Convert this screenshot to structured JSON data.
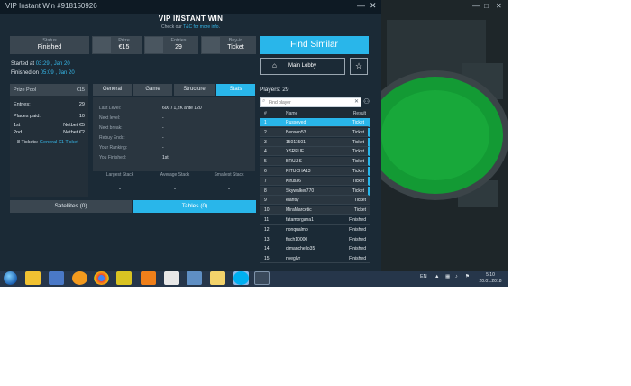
{
  "window": {
    "title": "VIP Instant Win #918150926",
    "controls": {
      "minimize": "—",
      "close": "✕"
    }
  },
  "header": {
    "title": "VIP INSTANT WIN",
    "subtitle_prefix": "Check our ",
    "subtitle_link": "T&C for more info",
    "subtitle_suffix": "."
  },
  "tiles": [
    {
      "label": "Status",
      "value": "Finished",
      "icon": "none"
    },
    {
      "label": "Prize",
      "value": "€15",
      "icon": "prize-icon"
    },
    {
      "label": "Entries",
      "value": "29",
      "icon": "entries-icon"
    },
    {
      "label": "Buy-in",
      "value": "Ticket",
      "icon": "buyin-icon"
    }
  ],
  "times": {
    "started_label": "Started at ",
    "started_value": "03:29 , Jan 20",
    "finished_label": "Finished on ",
    "finished_value": "05:09 , Jan 20"
  },
  "actions": {
    "find_similar": "Find Similar",
    "main_lobby": "Main Lobby"
  },
  "prize_panel": {
    "prize_pool_label": "Prize Pool",
    "prize_pool_value": "€15",
    "entries_label": "Entries:",
    "entries_value": "29",
    "places_paid_label": "Places paid:",
    "places_paid_value": "10",
    "places": [
      {
        "place": "1st",
        "prize": "Netbet €5"
      },
      {
        "place": "2nd",
        "prize": "Netbet €2"
      }
    ],
    "tickets_prefix": "8 Tickets: ",
    "tickets_value": "General €1 Ticket"
  },
  "tabs": [
    {
      "label": "General",
      "active": false
    },
    {
      "label": "Game",
      "active": false
    },
    {
      "label": "Structure",
      "active": false
    },
    {
      "label": "Stats",
      "active": true
    }
  ],
  "stats": [
    {
      "label": "Last Level:",
      "value": "600 / 1,2K ante 120"
    },
    {
      "label": "Next level:",
      "value": "-"
    },
    {
      "label": "Next break:",
      "value": "-"
    },
    {
      "label": "Rebuy Ends:",
      "value": "-"
    },
    {
      "label": "Your Ranking:",
      "value": "-"
    },
    {
      "label": "You Finished:",
      "value": "1st"
    }
  ],
  "stacks": [
    {
      "label": "Largest Stack",
      "value": "-"
    },
    {
      "label": "Average Stack",
      "value": "-"
    },
    {
      "label": "Smallest Stack",
      "value": "-"
    }
  ],
  "bottom_tabs": [
    {
      "label": "Satellites (0)",
      "active": false
    },
    {
      "label": "Tables (0)",
      "active": true
    }
  ],
  "players": {
    "label": "Players: ",
    "count": "29",
    "search_placeholder": "Find player",
    "columns": {
      "rank": "#",
      "name": "Name",
      "result": "Result"
    },
    "rows": [
      {
        "rank": "1",
        "name": "Russoved",
        "result": "Ticket"
      },
      {
        "rank": "2",
        "name": "Benson53",
        "result": "Ticket"
      },
      {
        "rank": "3",
        "name": "15011501",
        "result": "Ticket"
      },
      {
        "rank": "4",
        "name": "XSRFUF",
        "result": "Ticket"
      },
      {
        "rank": "5",
        "name": "BRUJIS",
        "result": "Ticket"
      },
      {
        "rank": "6",
        "name": "PITUCHA13",
        "result": "Ticket"
      },
      {
        "rank": "7",
        "name": "Kirus36",
        "result": "Ticket"
      },
      {
        "rank": "8",
        "name": "Skywalker770",
        "result": "Ticket"
      },
      {
        "rank": "9",
        "name": "elantiy",
        "result": "Ticket"
      },
      {
        "rank": "10",
        "name": "MiraMarcetic",
        "result": "Ticket"
      },
      {
        "rank": "11",
        "name": "fatamorgana1",
        "result": "Finished"
      },
      {
        "rank": "12",
        "name": "nonqualmo",
        "result": "Finished"
      },
      {
        "rank": "13",
        "name": "fisch10000",
        "result": "Finished"
      },
      {
        "rank": "14",
        "name": "dimanchello35",
        "result": "Finished"
      },
      {
        "rank": "15",
        "name": "nveglvr",
        "result": "Finished"
      }
    ]
  },
  "background_window": {
    "controls": {
      "minimize": "—",
      "maximize": "□",
      "close": "✕"
    }
  },
  "taskbar": {
    "language": "EN",
    "time": "5:10",
    "date": "20.01.2018",
    "apps": [
      "explorer-icon",
      "media-icon",
      "avast-icon",
      "chrome-icon",
      "zip-icon",
      "vlc-icon",
      "paint-icon",
      "folder-icon",
      "word-icon",
      "notes-icon",
      "skype-icon",
      "skype-alt-icon",
      "poker-icon"
    ],
    "colors": {
      "taskbar": "#26364a",
      "accent": "#29b6ea"
    }
  }
}
